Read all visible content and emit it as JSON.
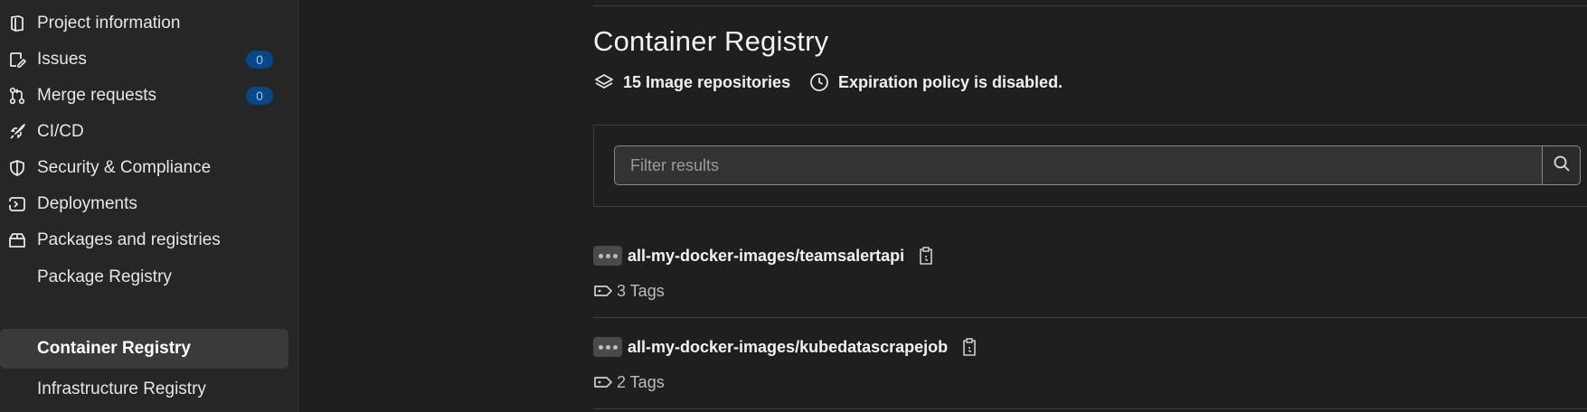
{
  "sidebar": {
    "items": [
      {
        "label": "Project information",
        "icon": "project-info-icon"
      },
      {
        "label": "Issues",
        "icon": "issues-icon",
        "badge": "0"
      },
      {
        "label": "Merge requests",
        "icon": "merge-request-icon",
        "badge": "0"
      },
      {
        "label": "CI/CD",
        "icon": "rocket-icon"
      },
      {
        "label": "Security & Compliance",
        "icon": "shield-icon"
      },
      {
        "label": "Deployments",
        "icon": "deployments-icon"
      },
      {
        "label": "Packages and registries",
        "icon": "package-icon"
      },
      {
        "label": "Package Registry"
      },
      {
        "label": "Container Registry",
        "active": true
      },
      {
        "label": "Infrastructure Registry"
      }
    ]
  },
  "main": {
    "title": "Container Registry",
    "repo_count": "15 Image repositories",
    "expiration": "Expiration policy is disabled.",
    "filter": {
      "placeholder": "Filter results",
      "value": ""
    },
    "repositories": [
      {
        "name": "all-my-docker-images/teamsalertapi",
        "tags": "3 Tags"
      },
      {
        "name": "all-my-docker-images/kubedatascrapejob",
        "tags": "2 Tags"
      }
    ]
  },
  "colors": {
    "background": "#1f1f1f",
    "sidebar": "#262626",
    "badge_bg": "#064787",
    "badge_text": "#9cc5f7",
    "active_item": "#3a3a3a"
  }
}
